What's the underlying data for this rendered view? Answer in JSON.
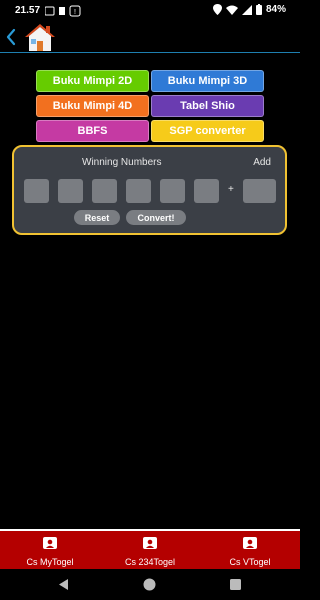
{
  "status": {
    "time": "21.57",
    "battery": "84%"
  },
  "buttons": [
    {
      "label": "Buku Mimpi 2D",
      "color": "#66cc00"
    },
    {
      "label": "Buku Mimpi 3D",
      "color": "#2f7ad6"
    },
    {
      "label": "Buku Mimpi 4D",
      "color": "#f2701f"
    },
    {
      "label": "Tabel Shio",
      "color": "#6a3cb1"
    },
    {
      "label": "BBFS",
      "color": "#c53aa3"
    },
    {
      "label": "SGP converter",
      "color": "#f6cb1a"
    }
  ],
  "panel": {
    "title": "Winning Numbers",
    "add": "Add",
    "plus": "+",
    "reset": "Reset",
    "convert": "Convert!"
  },
  "bottom_nav": [
    {
      "label": "Cs MyTogel",
      "icon": "contact-card-icon"
    },
    {
      "label": "Cs 234Togel",
      "icon": "contact-card-icon"
    },
    {
      "label": "Cs VTogel",
      "icon": "contact-card-icon"
    }
  ],
  "colors": {
    "accent": "#f1c232",
    "nav_red": "#b40000",
    "panel_bg": "#3b3f46"
  }
}
